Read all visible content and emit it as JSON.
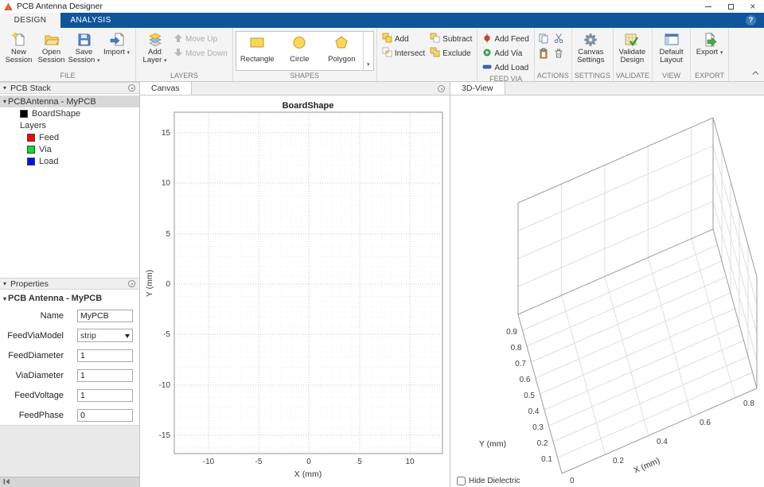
{
  "window": {
    "title": "PCB Antenna Designer"
  },
  "tab_strip": {
    "design": "DESIGN",
    "analysis": "ANALYSIS",
    "help": "?"
  },
  "ribbon": {
    "file": {
      "label": "FILE",
      "new_session": "New Session",
      "open_session": "Open Session",
      "save_session": "Save Session",
      "import": "Import"
    },
    "layers": {
      "label": "LAYERS",
      "add_layer": "Add Layer",
      "move_up": "Move Up",
      "move_down": "Move Down"
    },
    "shapes": {
      "label": "SHAPES",
      "rectangle": "Rectangle",
      "circle": "Circle",
      "polygon": "Polygon"
    },
    "boolean": {
      "add": "Add",
      "subtract": "Subtract",
      "intersect": "Intersect",
      "exclude": "Exclude"
    },
    "feed_via": {
      "label": "FEED VIA",
      "add_feed": "Add Feed",
      "add_via": "Add Via",
      "add_load": "Add Load"
    },
    "actions": {
      "label": "ACTIONS"
    },
    "settings": {
      "label": "SETTINGS",
      "canvas_settings": "Canvas Settings"
    },
    "validate": {
      "label": "VALIDATE",
      "validate_design": "Validate Design"
    },
    "view": {
      "label": "VIEW",
      "default_layout": "Default Layout"
    },
    "export": {
      "label": "EXPORT",
      "export": "Export"
    }
  },
  "pcb_stack": {
    "header": "PCB Stack",
    "root": "PCBAntenna - MyPCB",
    "board_shape": "BoardShape",
    "layers_group": "Layers",
    "feed": "Feed",
    "via": "Via",
    "load": "Load",
    "swatches": {
      "board_shape": "#000000",
      "feed": "#ff0000",
      "via": "#00e02a",
      "load": "#0010f0"
    }
  },
  "properties": {
    "header": "Properties",
    "group": "PCB Antenna - MyPCB",
    "rows": [
      {
        "label": "Name",
        "value": "MyPCB"
      },
      {
        "label": "FeedViaModel",
        "value": "strip"
      },
      {
        "label": "FeedDiameter",
        "value": "1"
      },
      {
        "label": "ViaDiameter",
        "value": "1"
      },
      {
        "label": "FeedVoltage",
        "value": "1"
      },
      {
        "label": "FeedPhase",
        "value": "0"
      }
    ]
  },
  "canvas_panel": {
    "tab": "Canvas"
  },
  "view3d_panel": {
    "tab": "3D-View",
    "hide_dielectric": "Hide Dielectric"
  },
  "chart_data": [
    {
      "type": "line",
      "title": "BoardShape",
      "xlabel": "X (mm)",
      "ylabel": "Y (mm)",
      "xlim": [
        -13.4,
        13.4
      ],
      "ylim": [
        -17,
        17
      ],
      "x_ticks": [
        -10,
        -5,
        0,
        5,
        10
      ],
      "y_ticks": [
        15,
        10,
        5,
        0,
        -5,
        -10,
        -15
      ],
      "grid": true,
      "series": [],
      "note": "empty 2D canvas axes - no shapes drawn yet"
    },
    {
      "type": "line",
      "projection": "3d",
      "xlabel": "X (mm)",
      "ylabel": "Y (mm)",
      "xlim": [
        0,
        0.9
      ],
      "ylim": [
        0,
        1
      ],
      "x_ticks": [
        0,
        0.2,
        0.4,
        0.6,
        0.8
      ],
      "y_ticks": [
        0.1,
        0.2,
        0.3,
        0.4,
        0.5,
        0.6,
        0.7,
        0.8,
        0.9
      ],
      "grid": true,
      "series": [],
      "note": "empty 3D axes box"
    }
  ]
}
